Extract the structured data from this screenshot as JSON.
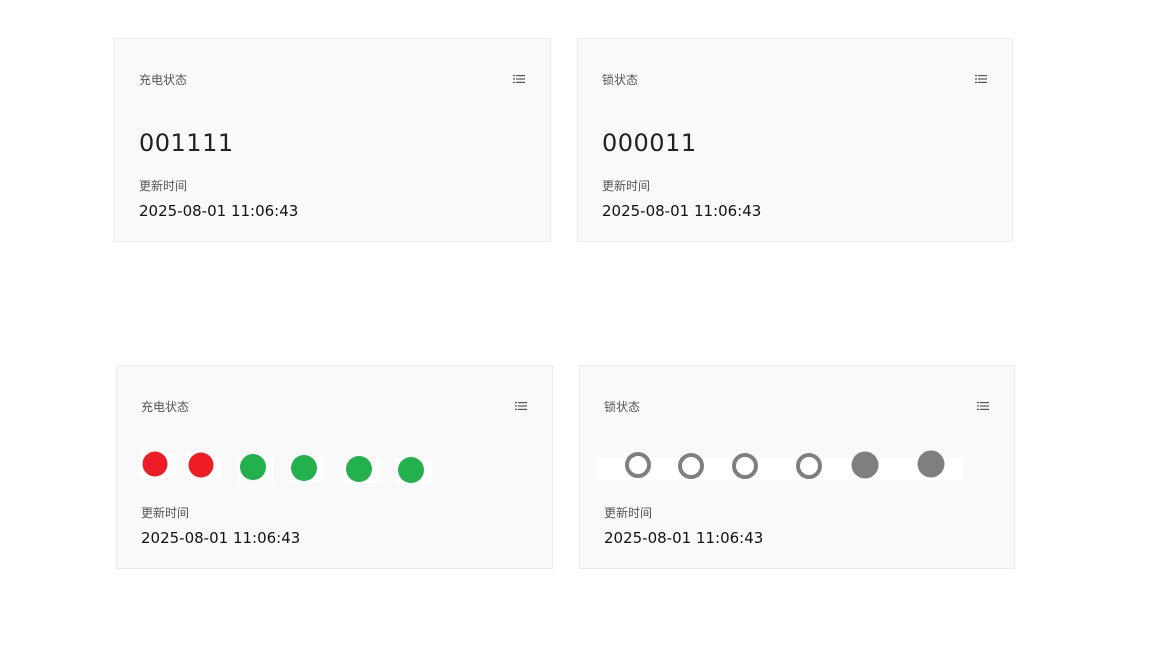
{
  "cards": [
    {
      "title": "充电状态",
      "value": "001111",
      "time_label": "更新时间",
      "time_value": "2025-08-01 11:06:43"
    },
    {
      "title": "锁状态",
      "value": "000011",
      "time_label": "更新时间",
      "time_value": "2025-08-01 11:06:43"
    },
    {
      "title": "充电状态",
      "time_label": "更新时间",
      "time_value": "2025-08-01 11:06:43",
      "indicators": [
        "0",
        "0",
        "1",
        "1",
        "1",
        "1"
      ],
      "colors": {
        "off": "#ee1c25",
        "on": "#22b14c"
      }
    },
    {
      "title": "锁状态",
      "time_label": "更新时间",
      "time_value": "2025-08-01 11:06:43",
      "indicators": [
        "0",
        "0",
        "0",
        "0",
        "1",
        "1"
      ],
      "colors": {
        "off": "#7f7f7f",
        "on": "#7f7f7f"
      }
    }
  ],
  "icons": {
    "menu": "list-icon"
  }
}
